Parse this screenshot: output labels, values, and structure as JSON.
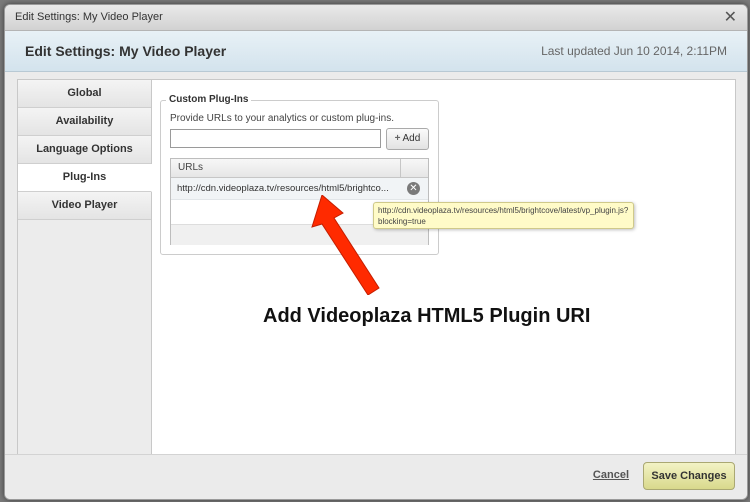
{
  "window": {
    "title": "Edit Settings: My Video Player",
    "close_icon": "close-icon"
  },
  "header": {
    "heading": "Edit Settings: My Video Player",
    "last_updated": "Last updated Jun 10 2014, 2:11PM"
  },
  "nav": {
    "items": [
      {
        "label": "Global",
        "active": false
      },
      {
        "label": "Availability",
        "active": false
      },
      {
        "label": "Language Options",
        "active": false
      },
      {
        "label": "Plug-Ins",
        "active": true
      },
      {
        "label": "Video Player",
        "active": false
      }
    ]
  },
  "plugins": {
    "legend": "Custom Plug-Ins",
    "description": "Provide URLs to your analytics or custom plug-ins.",
    "input_value": "",
    "add_label": "Add",
    "add_icon": "plus-icon",
    "grid_header": "URLs",
    "rows": [
      {
        "url": "http://cdn.videoplaza.tv/resources/html5/brightco...",
        "remove_icon": "remove-circle-icon"
      }
    ],
    "tooltip": "http://cdn.videoplaza.tv/resources/html5/brightcove/latest/vp_plugin.js?blocking=true"
  },
  "annotation": {
    "text": "Add Videoplaza HTML5 Plugin URI",
    "arrow_color": "#ff2a00"
  },
  "footer": {
    "cancel_label": "Cancel",
    "save_label": "Save Changes"
  }
}
